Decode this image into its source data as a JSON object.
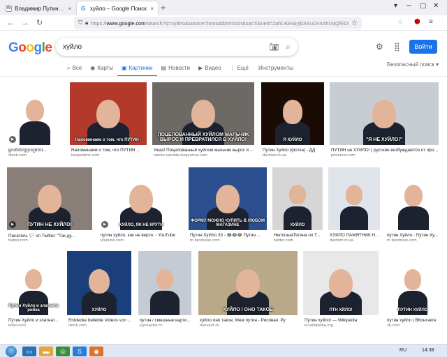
{
  "browser": {
    "tabs": [
      {
        "title": "Владимир Путин — о действ",
        "active": false,
        "close": "×"
      },
      {
        "title": "хуйло – Google Поиск",
        "active": true,
        "close": "×"
      }
    ],
    "new_tab": "+",
    "url_domain": "www.google.com",
    "url_prefix": "https://",
    "url_rest": "/search?q=хуйло&source=lnms&tbm=isch&sa=X&ved=2ahUKEwiyjbXKuOv4AhUqQfEDHSza",
    "window_controls": [
      "▾",
      "─",
      "▢",
      "✕"
    ]
  },
  "google": {
    "logo_letters": [
      "G",
      "o",
      "o",
      "g",
      "l",
      "e"
    ],
    "query": "хуйло",
    "sign_in": "Войти",
    "tabs": [
      {
        "icon": "⌕",
        "label": "Все",
        "selected": false
      },
      {
        "icon": "◉",
        "label": "Карты",
        "selected": false
      },
      {
        "icon": "▣",
        "label": "Картинки",
        "selected": true
      },
      {
        "icon": "▤",
        "label": "Новости",
        "selected": false
      },
      {
        "icon": "▶",
        "label": "Видео",
        "selected": false
      },
      {
        "icon": "⋮",
        "label": "Ещё",
        "selected": false
      }
    ],
    "tools": "Инструменты",
    "safe_search": "Безопасный поиск ▾"
  },
  "images": [
    {
      "caption": "អ្នកនាំពាក្យក្រសួងការ...",
      "source": "tiktok.com",
      "overlay": "",
      "bg": "#ffffff"
    },
    {
      "caption": "Напоминаем о том, что ПУТИН ...",
      "source": "keepcalms.com",
      "overlay": "Напоминаем о том, что ПУТИН -",
      "bg": "#b33a2a"
    },
    {
      "caption": "Ужас! Поцелованный хуйлом мальчик вырос и пр...",
      "source": "nashe-canada.livejournal.com",
      "overlay": "ПОЦЕЛОВАННЫЙ ХУЙЛОМ МАЛЬЧИК ВЫРОС И ПРЕВРАТИЛСЯ В ХУЙЛО!",
      "bg": "#6d6a66"
    },
    {
      "caption": "Путин Хуйло (фотка) - ДД",
      "source": "durdom.in.ua",
      "overlay": "Я ХУЙЛО",
      "bg": "#1a0c05"
    },
    {
      "caption": "ПУТИН не ХУЙЛО! ( русские возбуждаются от просмо...",
      "source": "pinterest.com",
      "overlay": "\"Я НЕ ХУЙЛО!\"",
      "bg": "#c8ccd3"
    },
    {
      "caption": "Писатель 🏳 on Twitter: \"Так ду...",
      "source": "twitter.com",
      "overlay": "ПУТИН НЕ ХУЙЛО!",
      "bg": "#8a7e79"
    },
    {
      "caption": "путин хуйло, как не верти. - YouTube",
      "source": "youtube.com",
      "overlay": "ХУЙЛО, ЯК НЕ КРУТИ",
      "bg": "#ffffff"
    },
    {
      "caption": "Путин ХуЙло 33 - 😂😂😂 Путин ...",
      "source": "m.facebook.com",
      "overlay": "ФОРМУ МОЖНО КУПИТЬ В ЛЮБОМ МАГАЗИНЕ",
      "bg": "#2b4f8e"
    },
    {
      "caption": "НепоганаТетяна on T...",
      "source": "twitter.com",
      "overlay": "ХУЙЛО",
      "bg": "#d6d6d6"
    },
    {
      "caption": "ХУЙЛО ПАМЯТНИК Н...",
      "source": "durdom.in.ua",
      "overlay": "",
      "bg": "#dfe3ea"
    },
    {
      "caption": "путин Хуйло - Путин Ху...",
      "source": "m.facebook.com",
      "overlay": "",
      "bg": "#ffffff"
    },
    {
      "caption": "Путин Хуйло и златнат...",
      "source": "kobo.com",
      "overlay": "Путин Хуйло и златната рибка",
      "bg": "#ffffff"
    },
    {
      "caption": "Entdecke beliebte Videos von ...",
      "source": "tiktok.com",
      "overlay": "ХУЙЛО",
      "bg": "#1b3f7a"
    },
    {
      "caption": "путин / смешные карти...",
      "source": "joyreactor.cc",
      "overlay": "",
      "bg": "#c5cad3"
    },
    {
      "caption": "хуйло оно такое, Мем путин - Рисовач .Ру",
      "source": "risovach.ru",
      "overlay": "ХУЙЛО / ОНО ТАКОЕ",
      "bg": "#b9a989"
    },
    {
      "caption": "Путин хуйло! — Wikipedia",
      "source": "kv.wikipedia.org",
      "overlay": "ПТН ХЙЛО!",
      "bg": "#e8e8e8"
    },
    {
      "caption": "путин хуйло | ВКонтакте",
      "source": "vk.com",
      "overlay": "ПУТИН ХУЙЛО",
      "bg": "#ffffff"
    }
  ],
  "taskbar": {
    "tray_lang": "RU",
    "tray_time": "14:38"
  },
  "colors": {
    "google_blue": "#1a73e8",
    "taskbar": "#dfe8f3"
  }
}
